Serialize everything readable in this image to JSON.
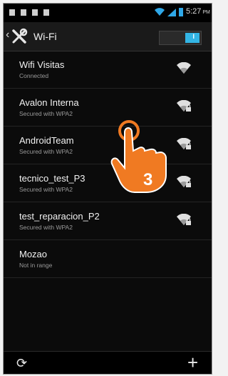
{
  "statusbar": {
    "time": "5:27",
    "ampm": "PM"
  },
  "header": {
    "title": "Wi-Fi",
    "toggle_label": "I",
    "toggle_on": true
  },
  "networks": [
    {
      "ssid": "Wifi Visitas",
      "status": "Connected",
      "icon": "wifi-icon"
    },
    {
      "ssid": "Avalon Interna",
      "status": "Secured with WPA2",
      "icon": "wifi-lock-icon"
    },
    {
      "ssid": "AndroidTeam",
      "status": "Secured with WPA2",
      "icon": "wifi-lock-icon"
    },
    {
      "ssid": "tecnico_test_P3",
      "status": "Secured with WPA2",
      "icon": "wifi-lock-icon"
    },
    {
      "ssid": "test_reparacion_P2",
      "status": "Secured with WPA2",
      "icon": "wifi-lock-icon"
    },
    {
      "ssid": "Mozao",
      "status": "Not in range",
      "icon": null
    }
  ],
  "annotation": {
    "step": "3"
  },
  "colors": {
    "accent": "#33b5e5",
    "step_orange": "#f07a22"
  }
}
